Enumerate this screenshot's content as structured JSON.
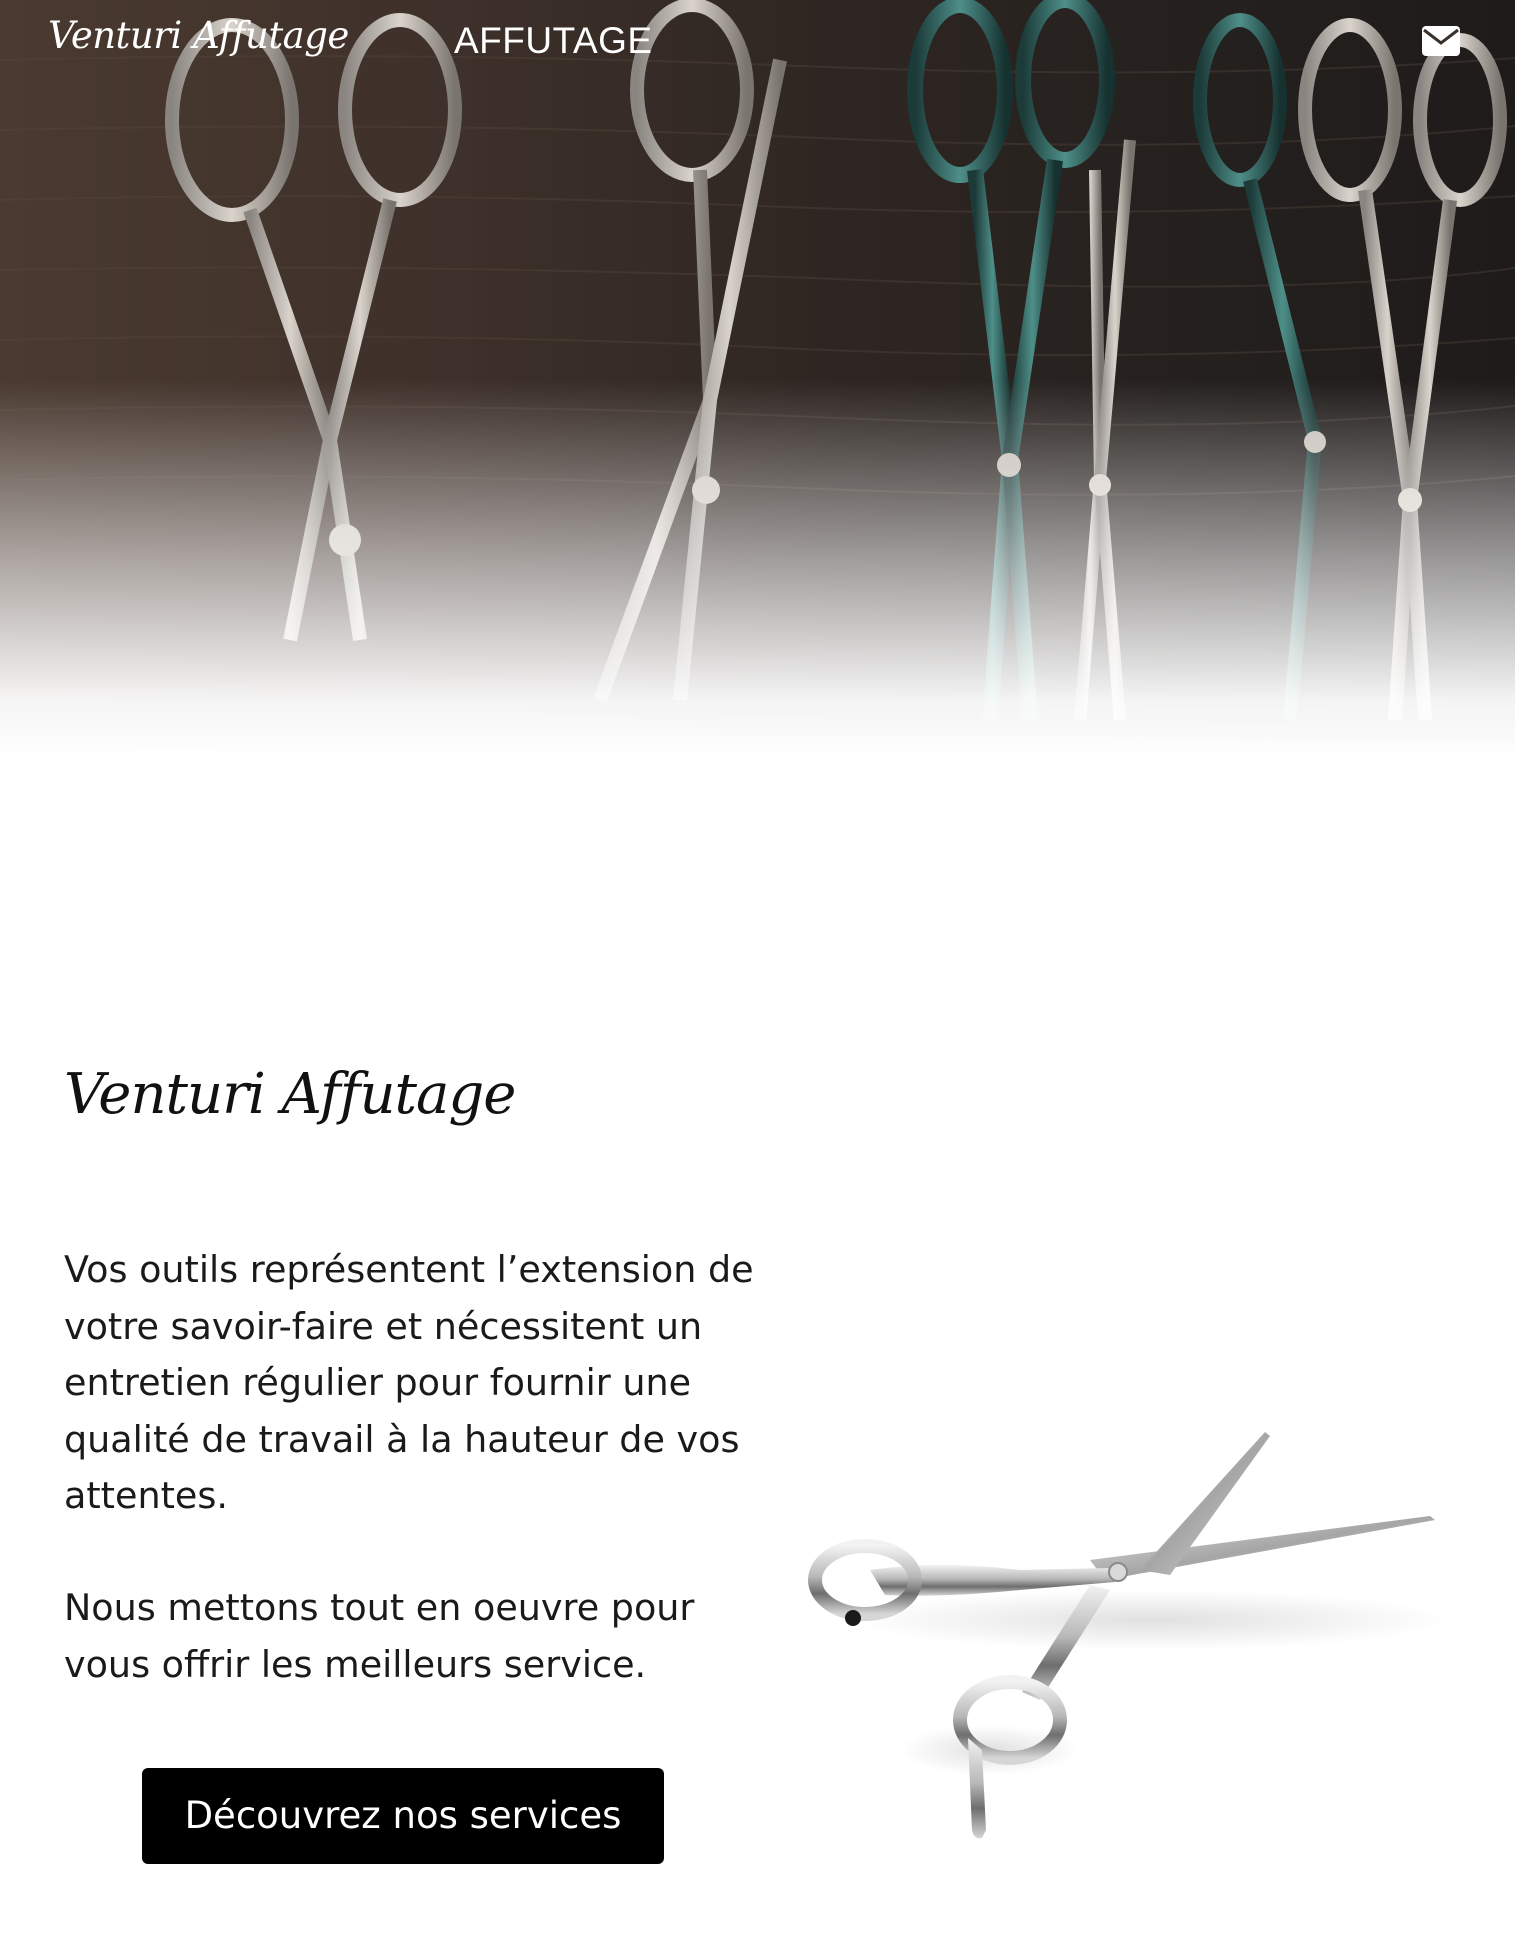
{
  "nav": {
    "logo": "Venturi Affutage",
    "link_label": "AFFUTAGE",
    "contact_icon": "envelope-icon"
  },
  "hero": {
    "image": "scissors-hanging-on-wood-photo"
  },
  "main": {
    "title": "Venturi Affutage",
    "paragraph_1": "Vos outils représentent l’extension de votre savoir-faire et nécessitent un entretien régulier pour fournir une qualité de travail à la hauteur de vos attentes.",
    "paragraph_2": "Nous mettons tout en oeuvre pour vous offrir les meilleurs service.",
    "cta_label": "Découvrez nos services",
    "product_image": "hairdressing-scissors-photo"
  },
  "colors": {
    "button_bg": "#000000",
    "button_text": "#ffffff",
    "nav_text": "#ffffff",
    "body_text": "#1a1a1a"
  }
}
